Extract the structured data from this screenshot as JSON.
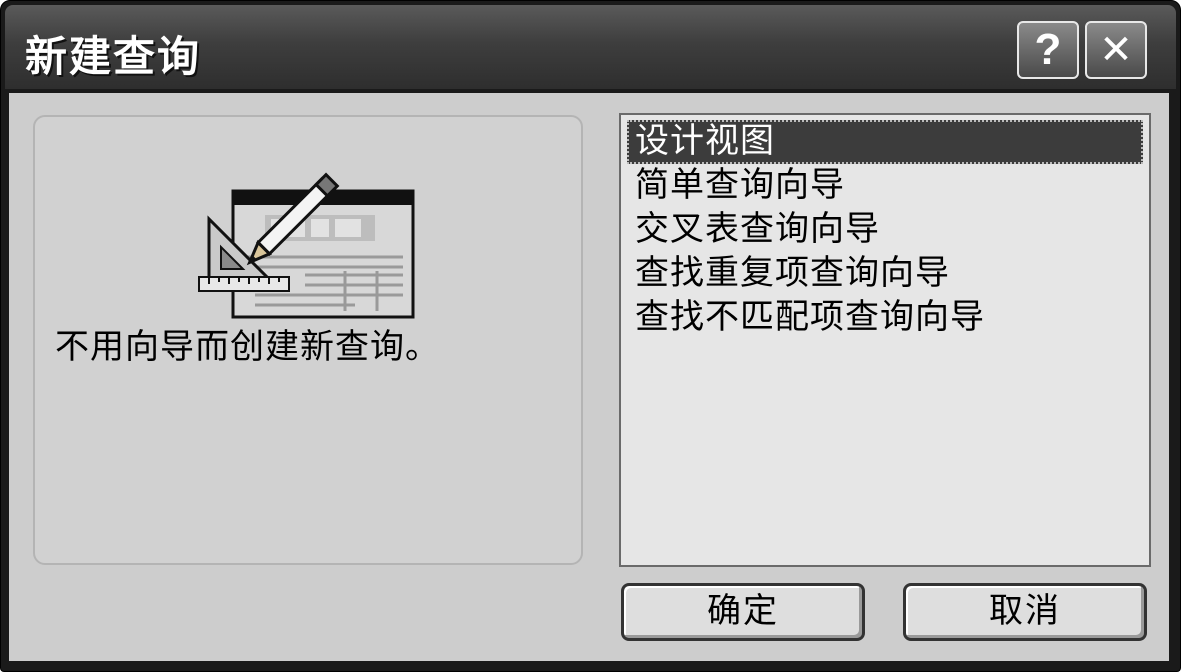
{
  "window": {
    "title": "新建查询"
  },
  "titlebar_buttons": {
    "help_glyph": "?",
    "close_glyph": "✕"
  },
  "left_panel": {
    "description": "不用向导而创建新查询。",
    "illustration_icon": "design-view-table-icon"
  },
  "list": {
    "items": [
      {
        "label": "设计视图",
        "selected": true
      },
      {
        "label": "简单查询向导",
        "selected": false
      },
      {
        "label": "交叉表查询向导",
        "selected": false
      },
      {
        "label": "查找重复项查询向导",
        "selected": false
      },
      {
        "label": "查找不匹配项查询向导",
        "selected": false
      }
    ]
  },
  "buttons": {
    "ok_label": "确定",
    "cancel_label": "取消"
  },
  "colors": {
    "titlebar": "#3e3e3e",
    "client_bg": "#cdcdcd",
    "selected_item_bg": "#3c3c3c"
  }
}
